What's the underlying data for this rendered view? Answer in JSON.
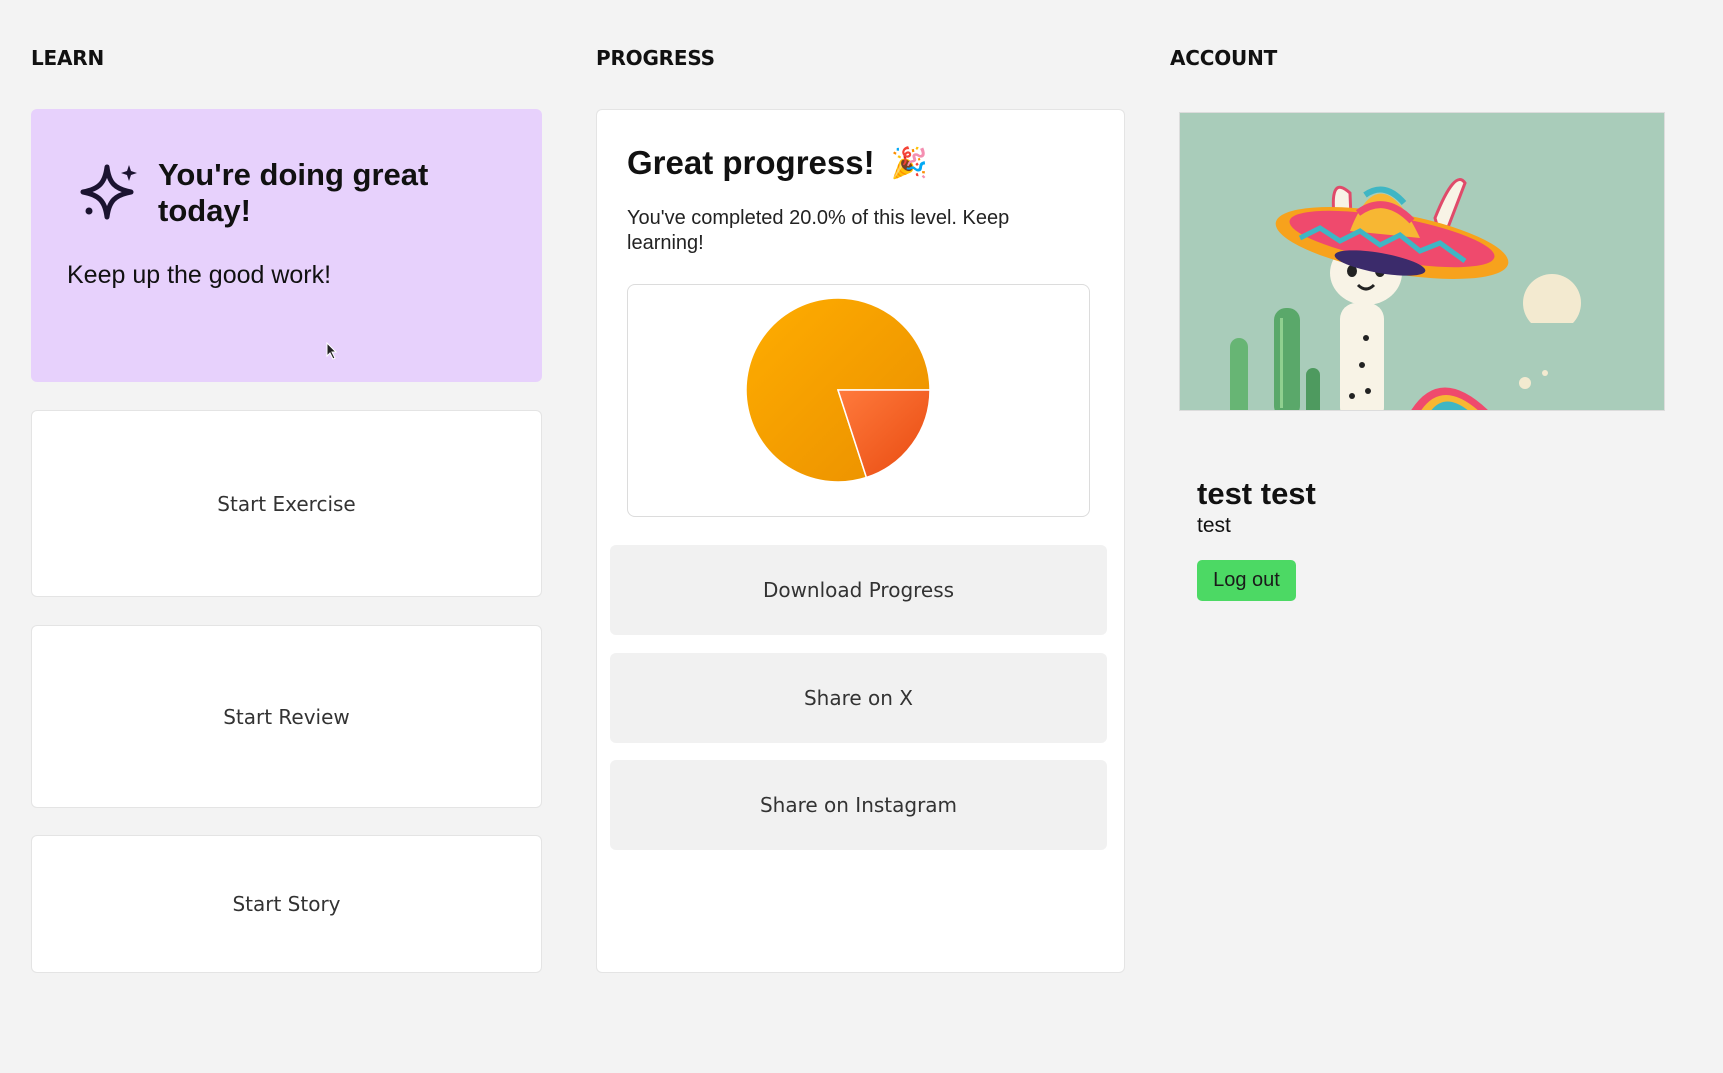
{
  "columns": {
    "learn": "LEARN",
    "progress": "PROGRESS",
    "account": "ACCOUNT"
  },
  "learn": {
    "hero_icon": "sparkle-icon",
    "hero_title": "You're doing great today!",
    "hero_subtitle": "Keep up the good work!",
    "actions": [
      "Start Exercise",
      "Start Review",
      "Start Story"
    ]
  },
  "progress": {
    "title": "Great progress!",
    "title_icon": "🎉",
    "text": "You've completed 20.0% of this level. Keep learning!",
    "buttons": [
      "Download Progress",
      "Share on X",
      "Share on Instagram"
    ]
  },
  "chart_data": {
    "type": "pie",
    "labels": [],
    "values": [
      80,
      20
    ],
    "colors": [
      "#f5a000",
      "#f26a2a"
    ]
  },
  "account": {
    "name": "test test",
    "username": "test",
    "logout_label": "Log out",
    "accent_color": "#4cd964"
  }
}
